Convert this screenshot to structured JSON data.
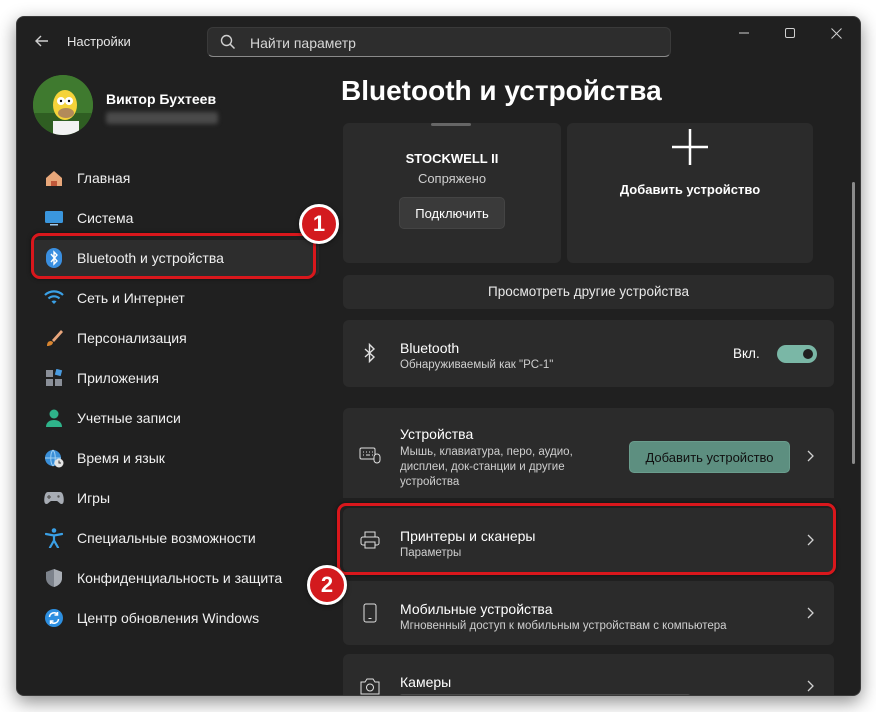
{
  "window": {
    "title": "Настройки",
    "search_placeholder": "Найти параметр"
  },
  "user": {
    "name": "Виктор Бухтеев"
  },
  "sidebar": {
    "items": [
      {
        "label": "Главная",
        "icon": "home-icon"
      },
      {
        "label": "Система",
        "icon": "system-icon"
      },
      {
        "label": "Bluetooth и устройства",
        "icon": "bluetooth-icon",
        "active": true
      },
      {
        "label": "Сеть и Интернет",
        "icon": "wifi-icon"
      },
      {
        "label": "Персонализация",
        "icon": "brush-icon"
      },
      {
        "label": "Приложения",
        "icon": "apps-icon"
      },
      {
        "label": "Учетные записи",
        "icon": "account-icon"
      },
      {
        "label": "Время и язык",
        "icon": "globe-clock-icon"
      },
      {
        "label": "Игры",
        "icon": "gamepad-icon"
      },
      {
        "label": "Специальные возможности",
        "icon": "accessibility-icon"
      },
      {
        "label": "Конфиденциальность и защита",
        "icon": "shield-icon"
      },
      {
        "label": "Центр обновления Windows",
        "icon": "update-icon"
      }
    ]
  },
  "main": {
    "title": "Bluetooth и устройства",
    "device_card": {
      "name": "STOCKWELL II",
      "status": "Сопряжено",
      "connect_label": "Подключить"
    },
    "add_device_card": {
      "label": "Добавить устройство"
    },
    "view_more_label": "Просмотреть другие устройства",
    "bluetooth": {
      "title": "Bluetooth",
      "subtitle": "Обнаруживаемый как \"PC-1\"",
      "state_label": "Вкл.",
      "enabled": true
    },
    "devices": {
      "title": "Устройства",
      "subtitle_line1": "Мышь, клавиатура, перо, аудио,",
      "subtitle_line2": "дисплеи, док-станции и другие",
      "subtitle_line3": "устройства",
      "add_button_label": "Добавить устройство"
    },
    "printers": {
      "title": "Принтеры и сканеры",
      "subtitle": "Параметры"
    },
    "mobile": {
      "title": "Мобильные устройства",
      "subtitle": "Мгновенный доступ к мобильным устройствам с компьютера"
    },
    "cameras": {
      "title": "Камеры"
    }
  },
  "annotations": {
    "marker1": "1",
    "marker2": "2",
    "color": "#d9171c"
  },
  "colors": {
    "accent": "#4cc2ff",
    "toggle_on": "#7ab7a6",
    "add_button": "#5d8f80"
  }
}
